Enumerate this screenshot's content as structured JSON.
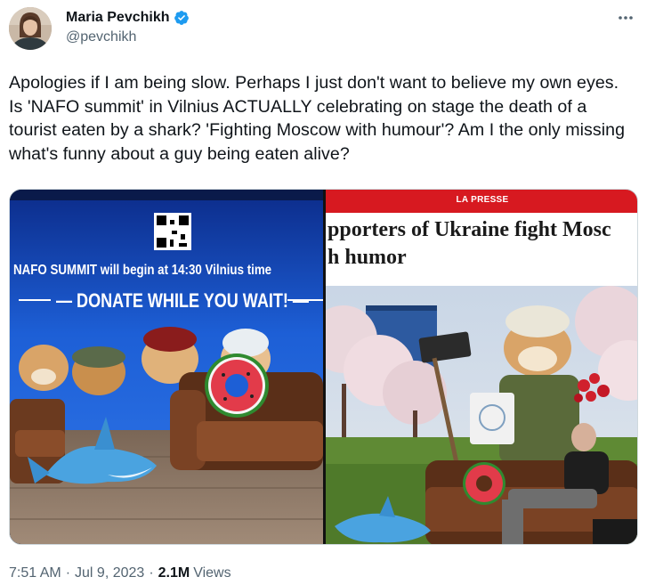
{
  "author": {
    "display_name": "Maria Pevchikh",
    "handle": "@pevchikh",
    "verified": true
  },
  "tweet": {
    "text": "Apologies if I am being slow. Perhaps I just don't want to believe my own eyes. Is 'NAFO summit' in Vilnius ACTUALLY celebrating on stage the death of a tourist eaten by a shark? 'Fighting Moscow with humour'? Am I the only missing what's funny about a guy being eaten alive?"
  },
  "media": {
    "left_image": {
      "screen_line1": "NAFO SUMMIT will begin at 14:30 Vilnius time",
      "screen_line2": "— DONATE WHILE YOU WAIT! —"
    },
    "right_image": {
      "publication": "LA PRESSE",
      "headline_line1": "pporters of Ukraine fight Mosc",
      "headline_line2": "h humor"
    }
  },
  "meta": {
    "time": "7:51 AM",
    "separator": "·",
    "date": "Jul 9, 2023",
    "views_count": "2.1M",
    "views_label": "Views"
  },
  "colors": {
    "text": "#0f1419",
    "secondary": "#536471",
    "verified": "#1d9bf0",
    "press_red": "#d71920"
  }
}
